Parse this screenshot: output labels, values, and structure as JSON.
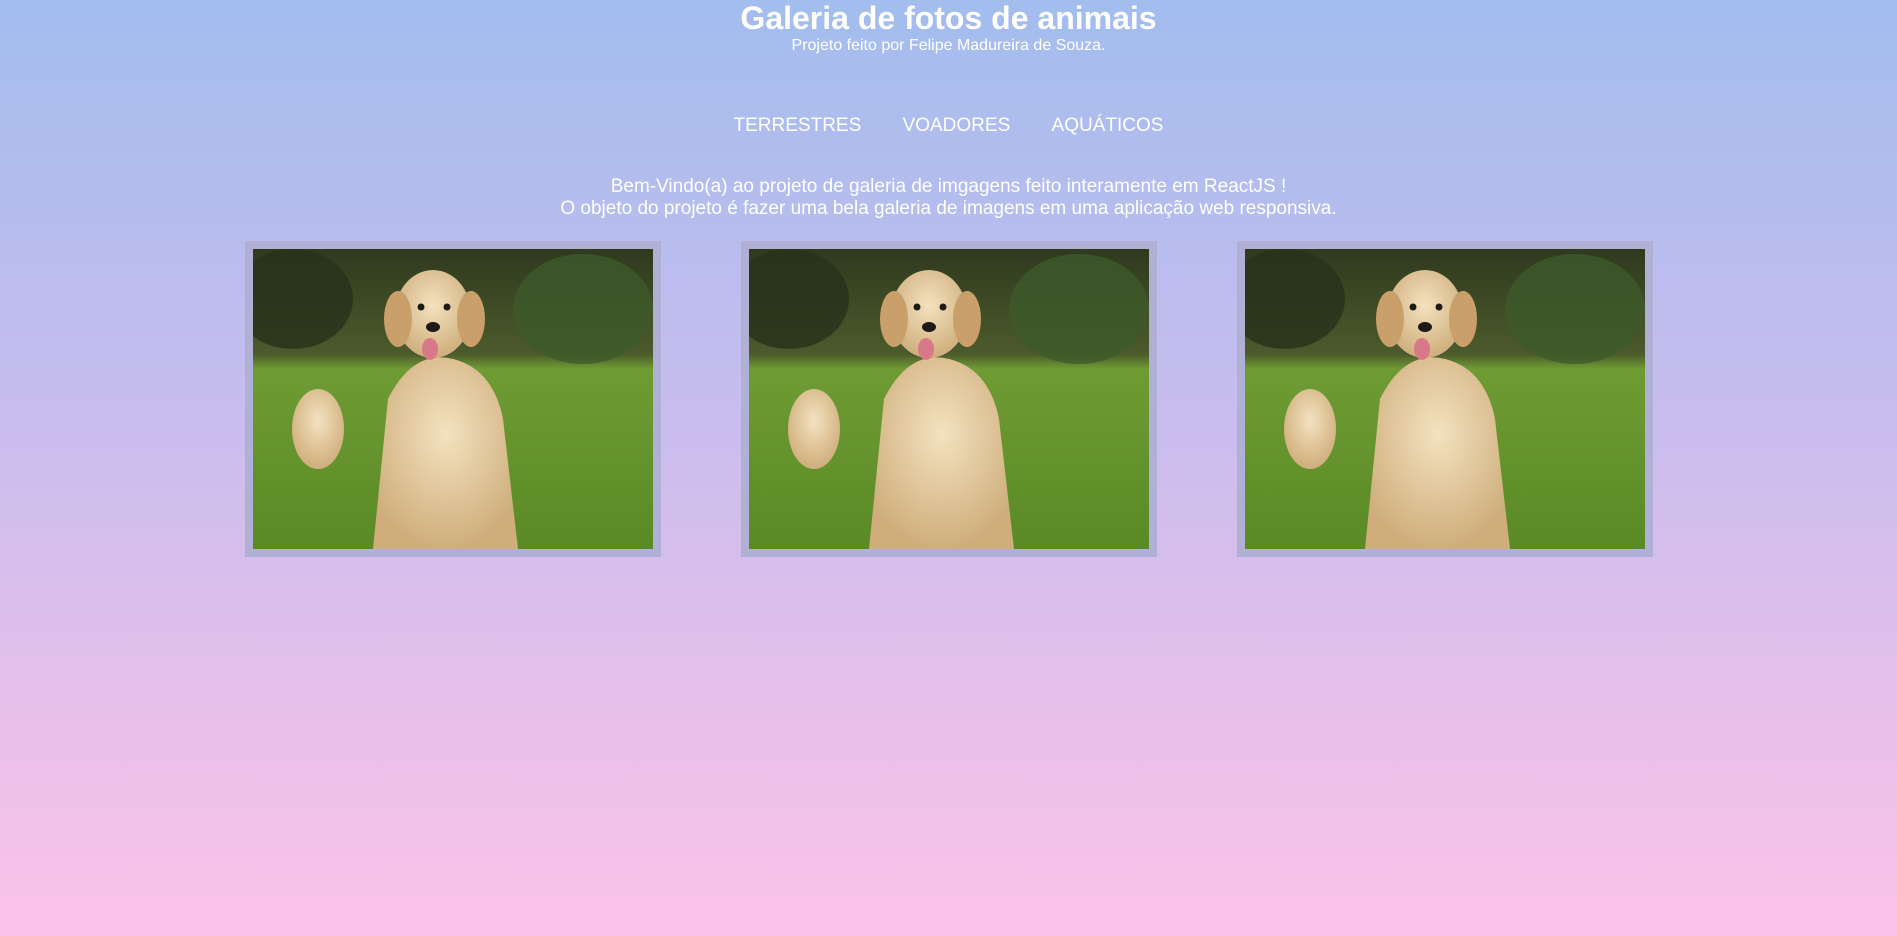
{
  "header": {
    "title": "Galeria de fotos de animais",
    "subtitle": "Projeto feito por Felipe Madureira de Souza."
  },
  "nav": {
    "items": [
      {
        "label": "TERRESTRES"
      },
      {
        "label": "VOADORES"
      },
      {
        "label": "AQUÁTICOS"
      }
    ]
  },
  "welcome": {
    "line1": "Bem-Vindo(a) ao projeto de galeria de imgagens feito interamente em ReactJS !",
    "line2": "O objeto do projeto é fazer uma bela galeria de imagens em uma aplicação web responsiva."
  },
  "gallery": {
    "photos": [
      {
        "subject": "golden-retriever-dog"
      },
      {
        "subject": "golden-retriever-dog"
      },
      {
        "subject": "golden-retriever-dog"
      }
    ]
  },
  "colors": {
    "background_top": "#a2bdee",
    "background_bottom": "#fbc2ea",
    "text": "#ffffff",
    "photo_border": "#b0b0d4"
  }
}
